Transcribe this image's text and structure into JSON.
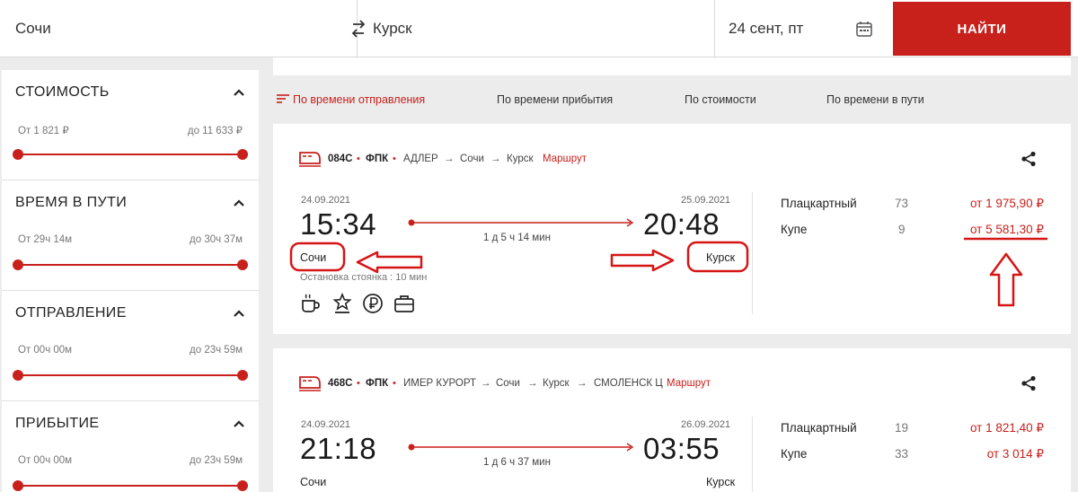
{
  "search": {
    "from_city": "Сочи",
    "to_city": "Курск",
    "date": "24 сент, пт",
    "find_label": "НАЙТИ",
    "swap_icon": "swap-icon",
    "calendar_icon": "calendar-icon"
  },
  "filters": [
    {
      "title": "СТОИМОСТЬ",
      "from": "От 1 821 ₽",
      "to": "до 11 633 ₽",
      "range": [
        0,
        1
      ]
    },
    {
      "title": "ВРЕМЯ В ПУТИ",
      "from": "От 29ч 14м",
      "to": "до 30ч 37м",
      "range": [
        0,
        1
      ]
    },
    {
      "title": "ОТПРАВЛЕНИЕ",
      "from": "От 00ч 00м",
      "to": "до 23ч 59м",
      "range": [
        0,
        1
      ]
    },
    {
      "title": "ПРИБЫТИЕ",
      "from": "От 00ч 00м",
      "to": "до 23ч 59м",
      "range": [
        0,
        1
      ]
    }
  ],
  "sort": {
    "active_index": 0,
    "options": [
      "По времени отправления",
      "По времени прибытия",
      "По стоимости",
      "По времени в пути"
    ]
  },
  "trains": [
    {
      "number": "084С",
      "sep": "•",
      "carrier": "ФПК",
      "stations": [
        "АДЛЕР",
        "Сочи",
        "Курск"
      ],
      "arrow": "→",
      "route_label": "Маршрут",
      "dep_date": "24.09.2021",
      "arr_date": "25.09.2021",
      "dep_time": "15:34",
      "arr_time": "20:48",
      "duration": "1 д 5 ч 14 мин",
      "dep_city": "Сочи",
      "arr_city": "Курск",
      "stop_info": "Остановка  стоянка : 10 мин",
      "services": [
        "coffee-icon",
        "star-award-icon",
        "ruble-icon",
        "luggage-icon"
      ],
      "classes": [
        {
          "name": "Плацкартный",
          "seats": "73",
          "price": "от 1 975,90 ₽"
        },
        {
          "name": "Купе",
          "seats": "9",
          "price": "от 5 581,30 ₽"
        }
      ]
    },
    {
      "number": "468С",
      "sep": "•",
      "carrier": "ФПК",
      "stations": [
        "ИМЕР КУРОРТ",
        "Сочи",
        "Курск",
        "СМОЛЕНСК Ц"
      ],
      "arrow": "→",
      "route_label": "Маршрут",
      "dep_date": "24.09.2021",
      "arr_date": "26.09.2021",
      "dep_time": "21:18",
      "arr_time": "03:55",
      "duration": "1 д 6 ч 37 мин",
      "dep_city": "Сочи",
      "arr_city": "Курск",
      "classes": [
        {
          "name": "Плацкартный",
          "seats": "19",
          "price": "от 1 821,40 ₽"
        },
        {
          "name": "Купе",
          "seats": "33",
          "price": "от 3 014 ₽"
        }
      ]
    }
  ],
  "colors": {
    "accent": "#c8211c",
    "background": "#ececec"
  }
}
